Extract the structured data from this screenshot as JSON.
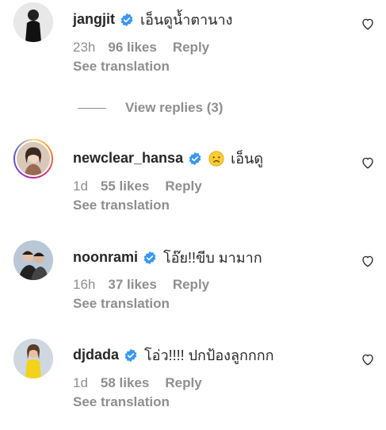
{
  "comments": [
    {
      "username": "jangjit",
      "text": "เอ็นดูน้ำตานาง",
      "time": "23h",
      "likes": "96 likes",
      "reply": "Reply",
      "translate": "See translation",
      "avatar_icon": "user-photo-icon"
    },
    {
      "username": "newclear_hansa",
      "text": "เอ็นดู",
      "emoji": "crying-face-icon",
      "time": "1d",
      "likes": "55 likes",
      "reply": "Reply",
      "translate": "See translation",
      "avatar_icon": "user-photo-icon",
      "story_ring": true
    },
    {
      "username": "noonrami",
      "text": "โอ๊ย!!ขีบ มามาก",
      "time": "16h",
      "likes": "37 likes",
      "reply": "Reply",
      "translate": "See translation",
      "avatar_icon": "user-photo-icon"
    },
    {
      "username": "djdada",
      "text": "โอ่ว!!!! ปกป้องลูกกกก",
      "time": "1d",
      "likes": "58 likes",
      "reply": "Reply",
      "translate": "See translation",
      "avatar_icon": "user-photo-icon"
    }
  ],
  "view_replies": "View replies (3)",
  "colors": {
    "text": "#262626",
    "secondary": "#8e8e8e",
    "verified": "#3897f0"
  }
}
